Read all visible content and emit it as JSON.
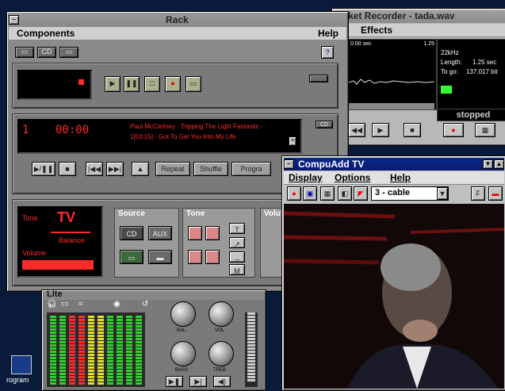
{
  "rack": {
    "title": "Rack",
    "menu": {
      "components": "Components",
      "help": "Help"
    },
    "cd": {
      "track": "1",
      "time": "00:00",
      "title_line1": "Paul McCartney - Tripping The Light Fantastic -",
      "title_line2": "1[03:15] - Got To Get You Into My Life",
      "repeat": "Repeat",
      "shuffle": "Shuffle",
      "program": "Progra"
    },
    "mixer": {
      "tone": "Tone",
      "tv": "TV",
      "balance": "Balance",
      "volume": "Volume",
      "source": "Source",
      "aux": "AUX",
      "tone2": "Tone",
      "volume_short": "Volu"
    }
  },
  "recorder": {
    "title": "ket Recorder - tada.wav",
    "menu_effects": "Effects",
    "time_left": "0.00 sec",
    "time_right": "1.25",
    "info_rate": "22kHz",
    "info_length_label": "Length:",
    "info_length": "1.25 sec",
    "info_togo_label": "To go:",
    "info_togo": "137,017 bit",
    "status": "stopped"
  },
  "tv": {
    "title": "CompuAdd TV",
    "menu": {
      "display": "Display",
      "options": "Options",
      "help": "Help"
    },
    "channel": "3 - cable"
  },
  "mixer_small": {
    "title": "Lite",
    "labels": {
      "bal": "BAL",
      "bass": "BASS",
      "vol": "VOL",
      "treb": "TREB"
    }
  },
  "desktop": {
    "icon_label": "rogram"
  },
  "colors": {
    "lcd_red": "#ff2a2a",
    "titlebar_active": "#0a2a8a",
    "window_gray": "#b8b8b8"
  }
}
